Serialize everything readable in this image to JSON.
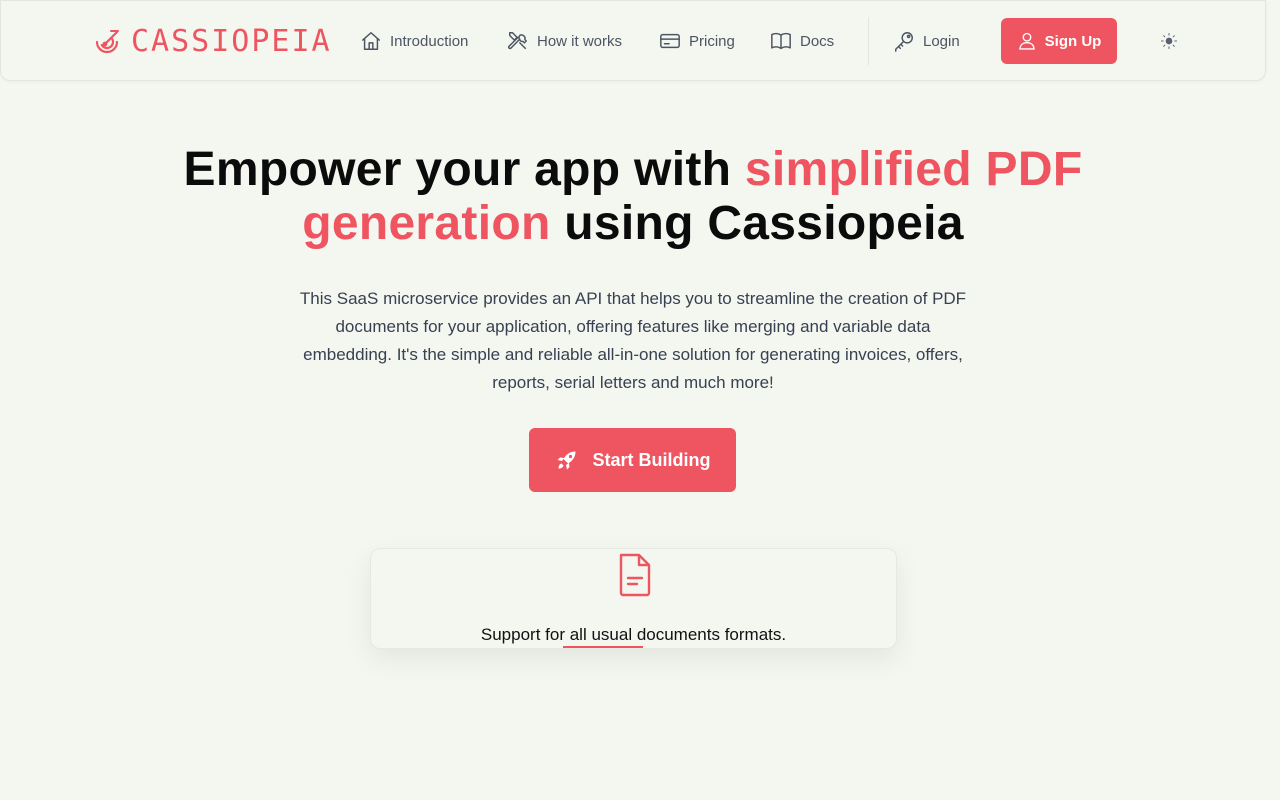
{
  "brand": {
    "name": "CASSIOPEIA",
    "color": "#ee5560"
  },
  "nav": {
    "items": [
      {
        "label": "Introduction",
        "icon": "home-icon"
      },
      {
        "label": "How it works",
        "icon": "tools-icon"
      },
      {
        "label": "Pricing",
        "icon": "credit-card-icon"
      },
      {
        "label": "Docs",
        "icon": "book-icon"
      }
    ],
    "login_label": "Login",
    "signup_label": "Sign Up",
    "theme_icon": "sun-icon"
  },
  "hero": {
    "title_part1": "Empower your app with ",
    "title_accent": "simplified PDF generation",
    "title_part2": " using Cassiopeia",
    "description": "This SaaS microservice provides an API that helps you to streamline the creation of PDF documents for your application, offering features like merging and variable data embedding. It's the simple and reliable all-in-one solution for generating invoices, offers, reports, serial letters and much more!",
    "cta_label": "Start Building",
    "cta_icon": "rocket-icon"
  },
  "feature": {
    "icon": "document-icon",
    "text": "Support for all usual documents formats."
  }
}
